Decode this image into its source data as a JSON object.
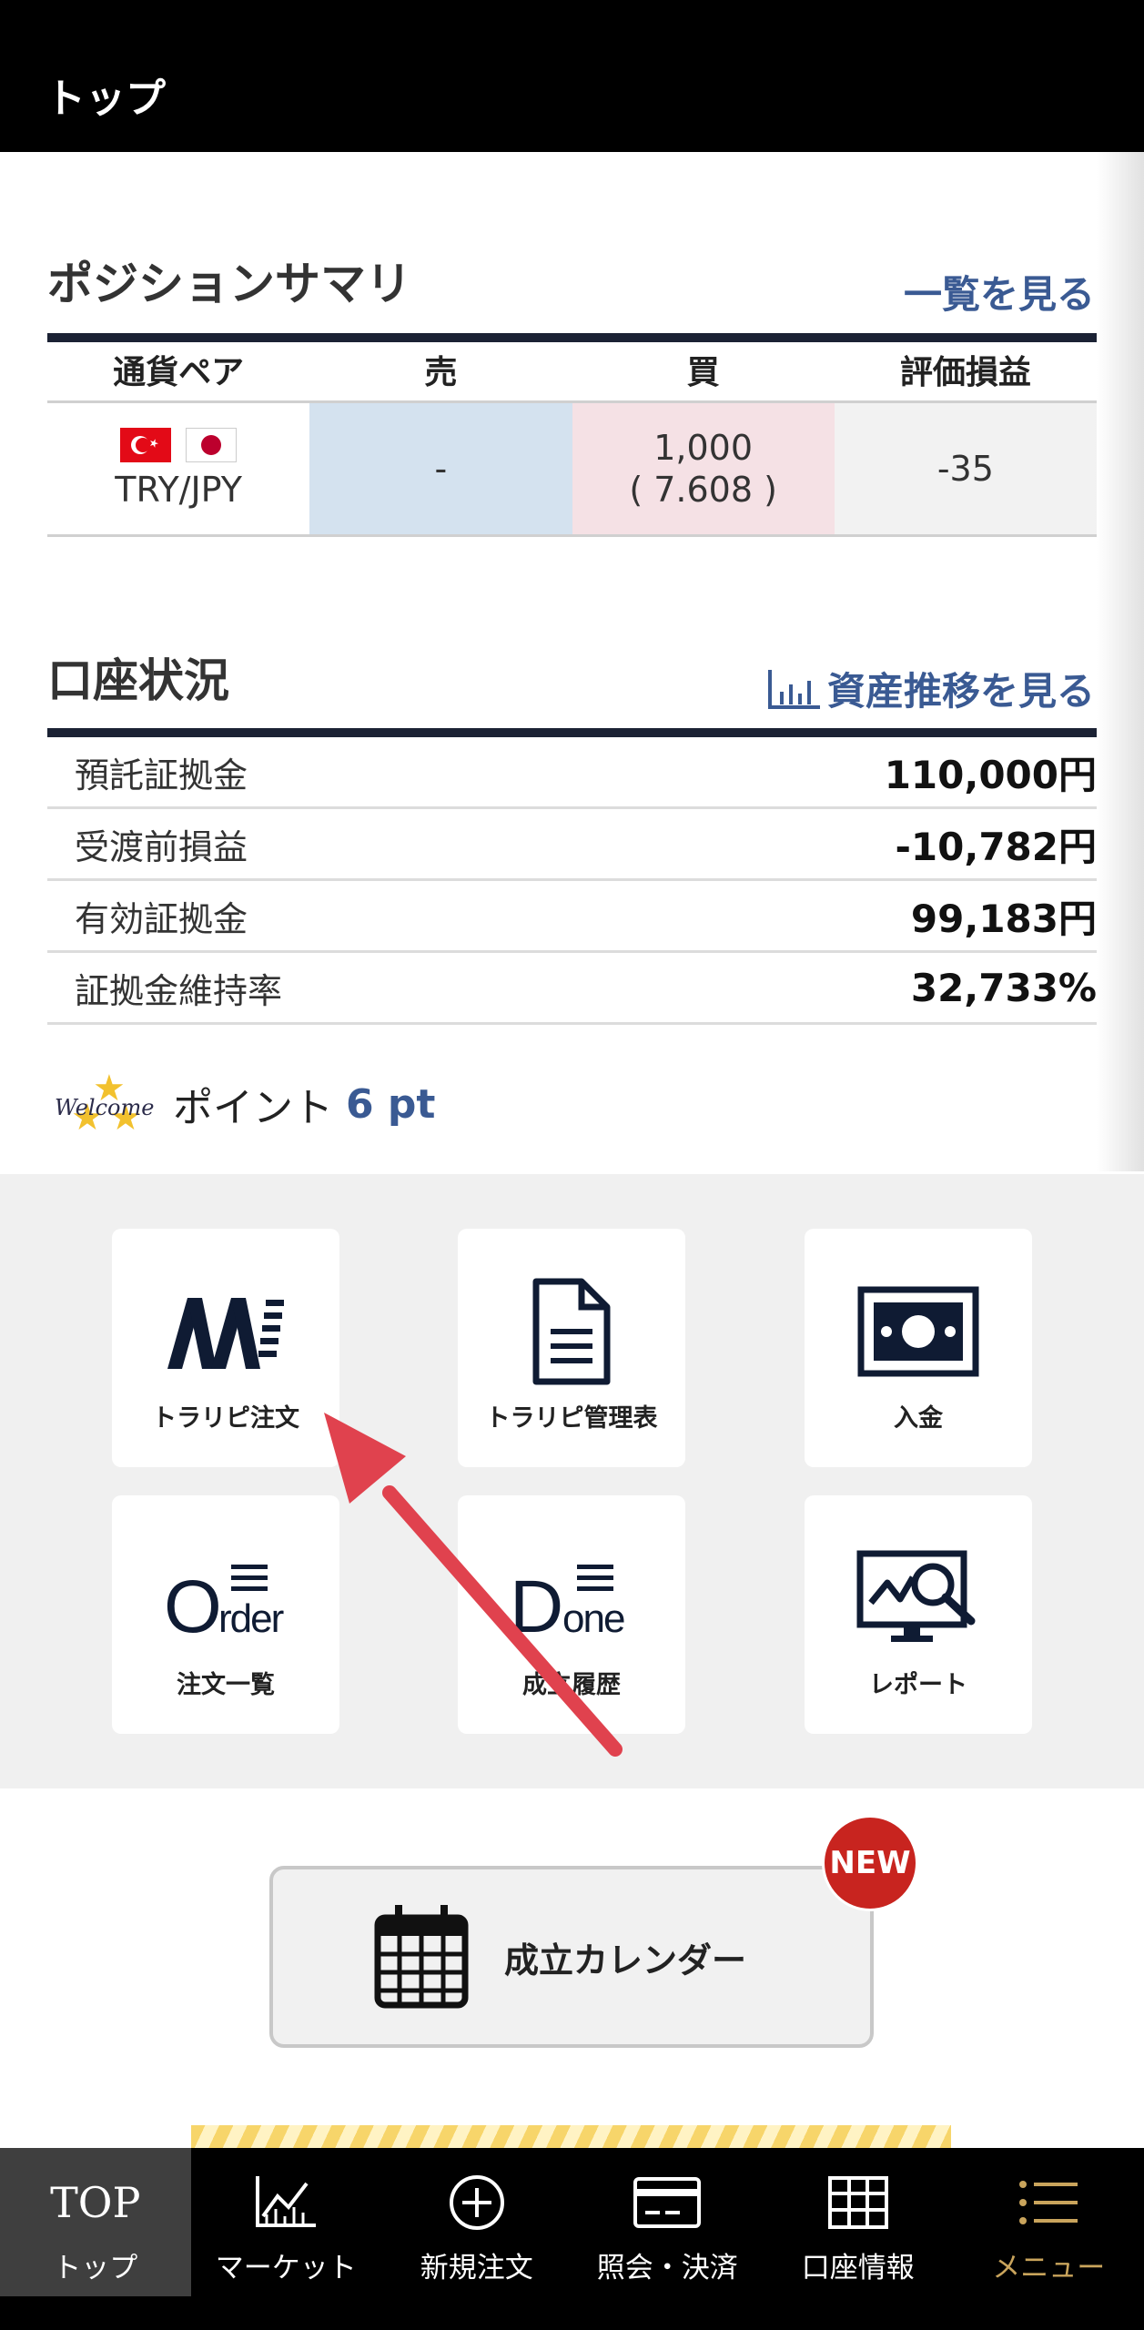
{
  "header": {
    "title": "トップ"
  },
  "position_summary": {
    "title": "ポジションサマリ",
    "link": "一覧を見る",
    "columns": [
      "通貨ペア",
      "売",
      "買",
      "評価損益"
    ],
    "rows": [
      {
        "pair": "TRY/JPY",
        "sell": "-",
        "buy_qty": "1,000",
        "buy_rate": "( 7.608 )",
        "pl": "-35"
      }
    ]
  },
  "account": {
    "title": "口座状況",
    "link": "資産推移を見る",
    "rows": [
      {
        "label": "預託証拠金",
        "value": "110,000円"
      },
      {
        "label": "受渡前損益",
        "value": "-10,782円"
      },
      {
        "label": "有効証拠金",
        "value": "99,183円"
      },
      {
        "label": "証拠金維持率",
        "value": "32,733%"
      }
    ]
  },
  "points": {
    "welcome": "Welcome",
    "label": "ポイント",
    "value": "6 pt"
  },
  "tiles": [
    {
      "label": "トラリピ注文",
      "icon": "trap-repeat-logo-icon"
    },
    {
      "label": "トラリピ管理表",
      "icon": "document-icon"
    },
    {
      "label": "入金",
      "icon": "banknote-icon"
    },
    {
      "label": "注文一覧",
      "icon": "order-list-icon",
      "glyph": "Order"
    },
    {
      "label": "成立履歴",
      "icon": "done-history-icon",
      "glyph": "Done"
    },
    {
      "label": "レポート",
      "icon": "report-icon"
    }
  ],
  "calendar": {
    "label": "成立カレンダー",
    "badge": "NEW"
  },
  "nav": [
    {
      "top": "TOP",
      "label": "トップ",
      "active": true
    },
    {
      "label": "マーケット",
      "icon": "chart-line-icon"
    },
    {
      "label": "新規注文",
      "icon": "plus-circle-icon"
    },
    {
      "label": "照会・決済",
      "icon": "card-icon"
    },
    {
      "label": "口座情報",
      "icon": "table-grid-icon"
    },
    {
      "label": "メニュー",
      "icon": "menu-list-icon"
    }
  ],
  "colors": {
    "accent_link": "#3a5a93",
    "header_bg": "#000000",
    "sell_bg": "#d4e2ef",
    "buy_bg": "#f5e1e5",
    "badge": "#c8241f",
    "menu_gold": "#c9a45c"
  }
}
